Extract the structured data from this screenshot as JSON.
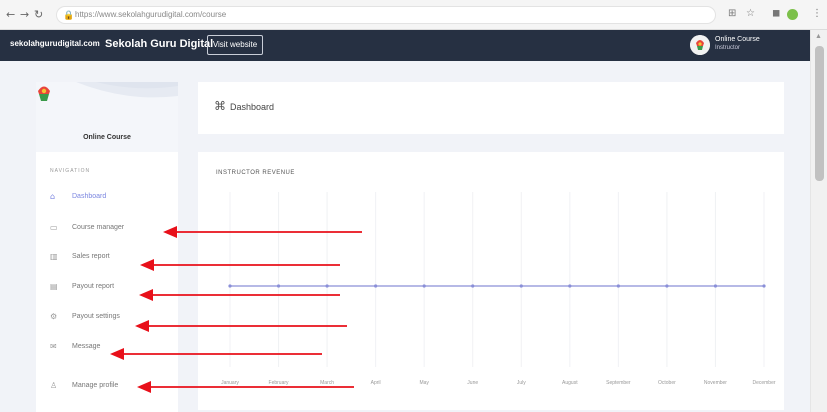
{
  "browser": {
    "url": "https://www.sekolahgurudigital.com/course",
    "back": "←",
    "forward": "→",
    "reload": "↻",
    "lock": "🔒",
    "menu": "⋮"
  },
  "topbar": {
    "domain": "sekolahgurudigital.com",
    "title": "Sekolah Guru Digital",
    "visit_button": "Visit website",
    "user_name": "Online Course",
    "user_role": "Instructor"
  },
  "sidebar": {
    "course_name": "Online Course",
    "section_label": "NAVIGATION",
    "items": [
      {
        "label": "Dashboard",
        "icon": "⌂",
        "icon_name": "dashboard-icon",
        "active": true
      },
      {
        "label": "Course manager",
        "icon": "▭",
        "icon_name": "course-manager-icon",
        "active": false
      },
      {
        "label": "Sales report",
        "icon": "▥",
        "icon_name": "sales-report-icon",
        "active": false
      },
      {
        "label": "Payout report",
        "icon": "▤",
        "icon_name": "payout-report-icon",
        "active": false
      },
      {
        "label": "Payout settings",
        "icon": "⚙",
        "icon_name": "payout-settings-icon",
        "active": false
      },
      {
        "label": "Message",
        "icon": "✉",
        "icon_name": "message-icon",
        "active": false
      },
      {
        "label": "Manage profile",
        "icon": "♙",
        "icon_name": "manage-profile-icon",
        "active": false
      }
    ]
  },
  "dashboard": {
    "icon": "⌘",
    "title": "Dashboard"
  },
  "revenue": {
    "title": "INSTRUCTOR REVENUE"
  },
  "chart_data": {
    "type": "line",
    "title": "INSTRUCTOR REVENUE",
    "categories": [
      "January",
      "February",
      "March",
      "April",
      "May",
      "June",
      "July",
      "August",
      "September",
      "October",
      "November",
      "December"
    ],
    "series": [
      {
        "values": [
          0,
          0,
          0,
          0,
          0,
          0,
          0,
          0,
          0,
          0,
          0,
          0
        ]
      }
    ],
    "grid": true,
    "legend": "none"
  },
  "colors": {
    "topbar": "#263042",
    "accent": "#7b86e0",
    "arrow": "#e8101a",
    "line": "#8a8fd8"
  }
}
